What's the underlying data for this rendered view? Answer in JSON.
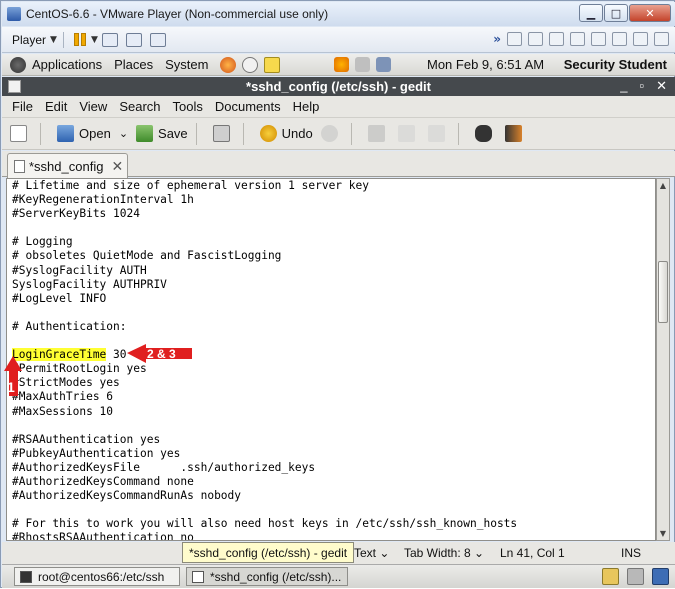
{
  "vm_window": {
    "title": "CentOS-6.6 - VMware Player (Non-commercial use only)"
  },
  "vm_toolbar": {
    "player_label": "Player"
  },
  "gnome_panel": {
    "menus": [
      "Applications",
      "Places",
      "System"
    ],
    "clock": "Mon Feb  9,  6:51 AM",
    "user": "Security Student"
  },
  "gedit": {
    "title": "*sshd_config (/etc/ssh) - gedit",
    "menu": [
      "File",
      "Edit",
      "View",
      "Search",
      "Tools",
      "Documents",
      "Help"
    ],
    "toolbar": {
      "open_label": "Open",
      "save_label": "Save",
      "undo_label": "Undo"
    },
    "tab_label": "*sshd_config",
    "code_lines": [
      "# Lifetime and size of ephemeral version 1 server key",
      "#KeyRegenerationInterval 1h",
      "#ServerKeyBits 1024",
      "",
      "# Logging",
      "# obsoletes QuietMode and FascistLogging",
      "#SyslogFacility AUTH",
      "SyslogFacility AUTHPRIV",
      "#LogLevel INFO",
      "",
      "# Authentication:",
      "",
      "LoginGraceTime 30",
      "#PermitRootLogin yes",
      "#StrictModes yes",
      "#MaxAuthTries 6",
      "#MaxSessions 10",
      "",
      "#RSAAuthentication yes",
      "#PubkeyAuthentication yes",
      "#AuthorizedKeysFile      .ssh/authorized_keys",
      "#AuthorizedKeysCommand none",
      "#AuthorizedKeysCommandRunAs nobody",
      "",
      "# For this to work you will also need host keys in /etc/ssh/ssh_known_hosts",
      "#RhostsRSAAuthentication no"
    ],
    "highlight": {
      "keyword": "LoginGraceTime",
      "rest": " 30"
    },
    "status": {
      "tooltip": "*sshd_config (/etc/ssh) - gedit",
      "syntax": "Text",
      "tab_width": "Tab Width:  8",
      "position": "Ln 41, Col 1",
      "mode": "INS"
    }
  },
  "annotations": {
    "step1": "1",
    "step23": "2 & 3"
  },
  "taskbar": {
    "items": [
      "root@centos66:/etc/ssh",
      "*sshd_config (/etc/ssh)..."
    ]
  },
  "colors": {
    "highlight": "#ffff33",
    "annotation": "#e01f1f",
    "gedit_title_bg": "#45494d"
  }
}
